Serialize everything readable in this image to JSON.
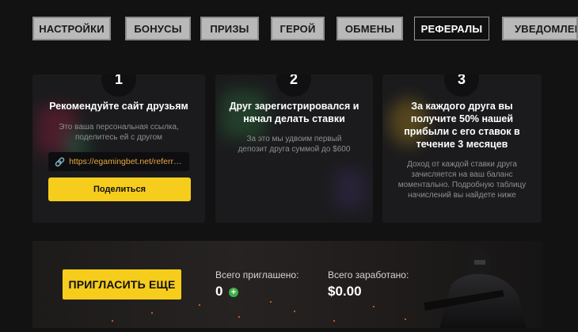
{
  "tabs": [
    {
      "label": "НАСТРОЙКИ",
      "active": false
    },
    {
      "label": "БОНУСЫ",
      "active": false
    },
    {
      "label": "ПРИЗЫ",
      "active": false
    },
    {
      "label": "ГЕРОЙ",
      "active": false
    },
    {
      "label": "ОБМЕНЫ",
      "active": false
    },
    {
      "label": "РЕФЕРАЛЫ",
      "active": true
    },
    {
      "label": "УВЕДОМЛЕНИ",
      "active": false
    }
  ],
  "steps": [
    {
      "number": "1",
      "title": "Рекомендуйте сайт друзьям",
      "description": "Это ваша персональная ссылка, поделитесь ей с другом",
      "link": "https://egamingbet.net/referra...",
      "button_label": "Поделиться"
    },
    {
      "number": "2",
      "title": "Друг зарегистрировался и начал делать ставки",
      "description": "За это мы удвоим первый депозит друга суммой до $600"
    },
    {
      "number": "3",
      "title": "За каждого друга вы получите 50% нашей прибыли с его ставок в течение 3 месяцев",
      "description": "Доход от каждой ставки друга зачисляется на ваш баланс моментально. Подробную таблицу начислений вы найдете ниже"
    }
  ],
  "banner": {
    "invite_button": "ПРИГЛАСИТЬ ЕЩЕ",
    "invited_label": "Всего приглашено:",
    "invited_value": "0",
    "earned_label": "Всего заработано:",
    "earned_value": "$0.00"
  },
  "colors": {
    "accent": "#f6cd1c",
    "link": "#e7a63f",
    "add_icon": "#3fae49"
  },
  "icons": {
    "link_icon": "link-icon",
    "add_icon": "plus-circle-icon"
  }
}
